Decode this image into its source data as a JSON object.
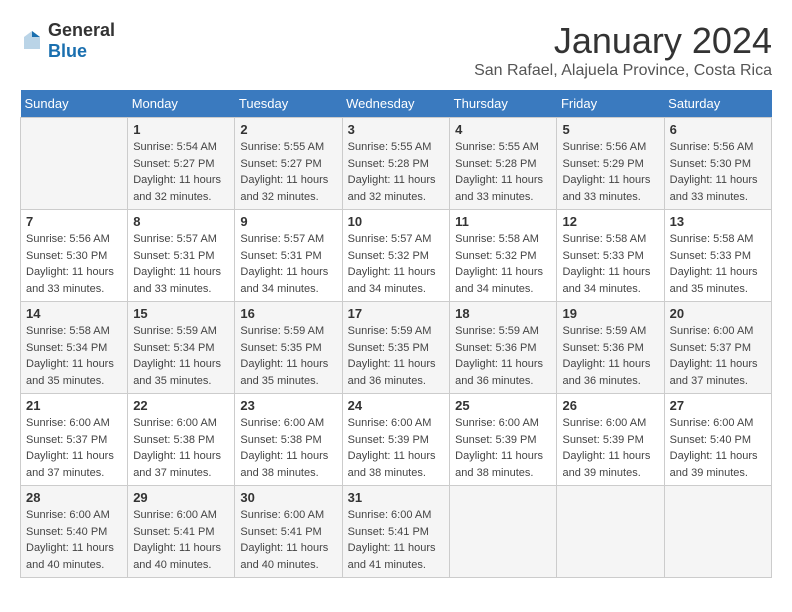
{
  "logo": {
    "text_general": "General",
    "text_blue": "Blue"
  },
  "title": "January 2024",
  "subtitle": "San Rafael, Alajuela Province, Costa Rica",
  "days_of_week": [
    "Sunday",
    "Monday",
    "Tuesday",
    "Wednesday",
    "Thursday",
    "Friday",
    "Saturday"
  ],
  "weeks": [
    [
      {
        "day": "",
        "sunrise": "",
        "sunset": "",
        "daylight": ""
      },
      {
        "day": "1",
        "sunrise": "Sunrise: 5:54 AM",
        "sunset": "Sunset: 5:27 PM",
        "daylight": "Daylight: 11 hours and 32 minutes."
      },
      {
        "day": "2",
        "sunrise": "Sunrise: 5:55 AM",
        "sunset": "Sunset: 5:27 PM",
        "daylight": "Daylight: 11 hours and 32 minutes."
      },
      {
        "day": "3",
        "sunrise": "Sunrise: 5:55 AM",
        "sunset": "Sunset: 5:28 PM",
        "daylight": "Daylight: 11 hours and 32 minutes."
      },
      {
        "day": "4",
        "sunrise": "Sunrise: 5:55 AM",
        "sunset": "Sunset: 5:28 PM",
        "daylight": "Daylight: 11 hours and 33 minutes."
      },
      {
        "day": "5",
        "sunrise": "Sunrise: 5:56 AM",
        "sunset": "Sunset: 5:29 PM",
        "daylight": "Daylight: 11 hours and 33 minutes."
      },
      {
        "day": "6",
        "sunrise": "Sunrise: 5:56 AM",
        "sunset": "Sunset: 5:30 PM",
        "daylight": "Daylight: 11 hours and 33 minutes."
      }
    ],
    [
      {
        "day": "7",
        "sunrise": "Sunrise: 5:56 AM",
        "sunset": "Sunset: 5:30 PM",
        "daylight": "Daylight: 11 hours and 33 minutes."
      },
      {
        "day": "8",
        "sunrise": "Sunrise: 5:57 AM",
        "sunset": "Sunset: 5:31 PM",
        "daylight": "Daylight: 11 hours and 33 minutes."
      },
      {
        "day": "9",
        "sunrise": "Sunrise: 5:57 AM",
        "sunset": "Sunset: 5:31 PM",
        "daylight": "Daylight: 11 hours and 34 minutes."
      },
      {
        "day": "10",
        "sunrise": "Sunrise: 5:57 AM",
        "sunset": "Sunset: 5:32 PM",
        "daylight": "Daylight: 11 hours and 34 minutes."
      },
      {
        "day": "11",
        "sunrise": "Sunrise: 5:58 AM",
        "sunset": "Sunset: 5:32 PM",
        "daylight": "Daylight: 11 hours and 34 minutes."
      },
      {
        "day": "12",
        "sunrise": "Sunrise: 5:58 AM",
        "sunset": "Sunset: 5:33 PM",
        "daylight": "Daylight: 11 hours and 34 minutes."
      },
      {
        "day": "13",
        "sunrise": "Sunrise: 5:58 AM",
        "sunset": "Sunset: 5:33 PM",
        "daylight": "Daylight: 11 hours and 35 minutes."
      }
    ],
    [
      {
        "day": "14",
        "sunrise": "Sunrise: 5:58 AM",
        "sunset": "Sunset: 5:34 PM",
        "daylight": "Daylight: 11 hours and 35 minutes."
      },
      {
        "day": "15",
        "sunrise": "Sunrise: 5:59 AM",
        "sunset": "Sunset: 5:34 PM",
        "daylight": "Daylight: 11 hours and 35 minutes."
      },
      {
        "day": "16",
        "sunrise": "Sunrise: 5:59 AM",
        "sunset": "Sunset: 5:35 PM",
        "daylight": "Daylight: 11 hours and 35 minutes."
      },
      {
        "day": "17",
        "sunrise": "Sunrise: 5:59 AM",
        "sunset": "Sunset: 5:35 PM",
        "daylight": "Daylight: 11 hours and 36 minutes."
      },
      {
        "day": "18",
        "sunrise": "Sunrise: 5:59 AM",
        "sunset": "Sunset: 5:36 PM",
        "daylight": "Daylight: 11 hours and 36 minutes."
      },
      {
        "day": "19",
        "sunrise": "Sunrise: 5:59 AM",
        "sunset": "Sunset: 5:36 PM",
        "daylight": "Daylight: 11 hours and 36 minutes."
      },
      {
        "day": "20",
        "sunrise": "Sunrise: 6:00 AM",
        "sunset": "Sunset: 5:37 PM",
        "daylight": "Daylight: 11 hours and 37 minutes."
      }
    ],
    [
      {
        "day": "21",
        "sunrise": "Sunrise: 6:00 AM",
        "sunset": "Sunset: 5:37 PM",
        "daylight": "Daylight: 11 hours and 37 minutes."
      },
      {
        "day": "22",
        "sunrise": "Sunrise: 6:00 AM",
        "sunset": "Sunset: 5:38 PM",
        "daylight": "Daylight: 11 hours and 37 minutes."
      },
      {
        "day": "23",
        "sunrise": "Sunrise: 6:00 AM",
        "sunset": "Sunset: 5:38 PM",
        "daylight": "Daylight: 11 hours and 38 minutes."
      },
      {
        "day": "24",
        "sunrise": "Sunrise: 6:00 AM",
        "sunset": "Sunset: 5:39 PM",
        "daylight": "Daylight: 11 hours and 38 minutes."
      },
      {
        "day": "25",
        "sunrise": "Sunrise: 6:00 AM",
        "sunset": "Sunset: 5:39 PM",
        "daylight": "Daylight: 11 hours and 38 minutes."
      },
      {
        "day": "26",
        "sunrise": "Sunrise: 6:00 AM",
        "sunset": "Sunset: 5:39 PM",
        "daylight": "Daylight: 11 hours and 39 minutes."
      },
      {
        "day": "27",
        "sunrise": "Sunrise: 6:00 AM",
        "sunset": "Sunset: 5:40 PM",
        "daylight": "Daylight: 11 hours and 39 minutes."
      }
    ],
    [
      {
        "day": "28",
        "sunrise": "Sunrise: 6:00 AM",
        "sunset": "Sunset: 5:40 PM",
        "daylight": "Daylight: 11 hours and 40 minutes."
      },
      {
        "day": "29",
        "sunrise": "Sunrise: 6:00 AM",
        "sunset": "Sunset: 5:41 PM",
        "daylight": "Daylight: 11 hours and 40 minutes."
      },
      {
        "day": "30",
        "sunrise": "Sunrise: 6:00 AM",
        "sunset": "Sunset: 5:41 PM",
        "daylight": "Daylight: 11 hours and 40 minutes."
      },
      {
        "day": "31",
        "sunrise": "Sunrise: 6:00 AM",
        "sunset": "Sunset: 5:41 PM",
        "daylight": "Daylight: 11 hours and 41 minutes."
      },
      {
        "day": "",
        "sunrise": "",
        "sunset": "",
        "daylight": ""
      },
      {
        "day": "",
        "sunrise": "",
        "sunset": "",
        "daylight": ""
      },
      {
        "day": "",
        "sunrise": "",
        "sunset": "",
        "daylight": ""
      }
    ]
  ]
}
